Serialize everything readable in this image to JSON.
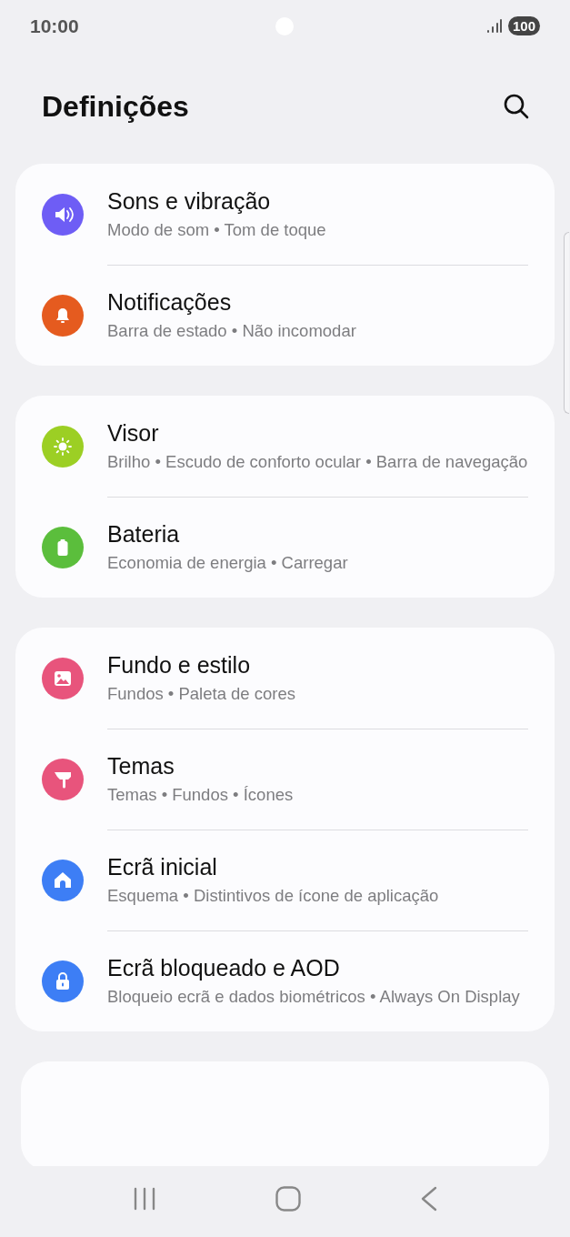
{
  "status_bar": {
    "time": "10:00",
    "battery": "100"
  },
  "header": {
    "title": "Definições"
  },
  "groups": [
    {
      "items": [
        {
          "title": "Sons e vibração",
          "subtitle": "Modo de som • Tom de toque",
          "color": "#6e5df5"
        },
        {
          "title": "Notificações",
          "subtitle": "Barra de estado • Não incomodar",
          "color": "#e55b1f"
        }
      ]
    },
    {
      "items": [
        {
          "title": "Visor",
          "subtitle": "Brilho • Escudo de conforto ocular • Barra de navegação",
          "color": "#9ccf24"
        },
        {
          "title": "Bateria",
          "subtitle": "Economia de energia • Carregar",
          "color": "#5bbe3c"
        }
      ]
    },
    {
      "items": [
        {
          "title": "Fundo e estilo",
          "subtitle": "Fundos • Paleta de cores",
          "color": "#e8547c"
        },
        {
          "title": "Temas",
          "subtitle": "Temas • Fundos • Ícones",
          "color": "#e8547c"
        },
        {
          "title": "Ecrã inicial",
          "subtitle": "Esquema • Distintivos de ícone de aplicação",
          "color": "#3d7ef5"
        },
        {
          "title": "Ecrã bloqueado e AOD",
          "subtitle": "Bloqueio ecrã e dados biométricos • Always On Display",
          "color": "#3d7ef5"
        }
      ]
    }
  ]
}
